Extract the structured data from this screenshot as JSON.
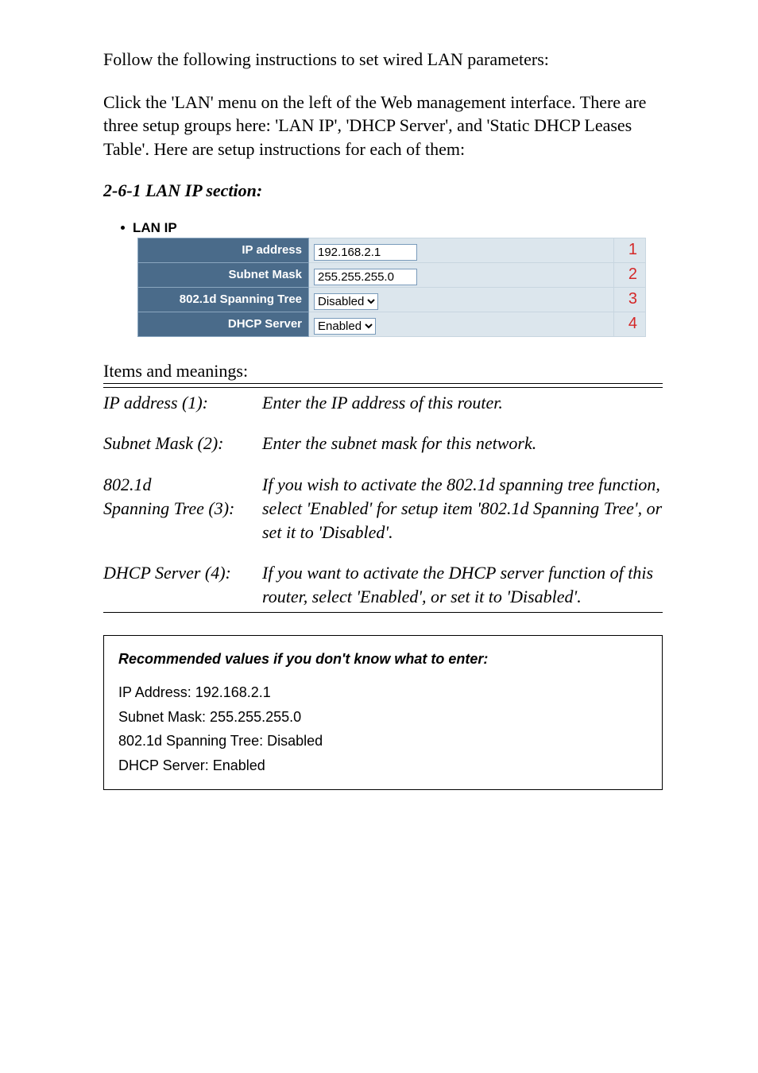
{
  "intro1": "Follow the following instructions to set wired LAN parameters:",
  "intro2": "Click the 'LAN' menu on the left of the Web management interface. There are three setup groups here: 'LAN IP', 'DHCP Server', and 'Static DHCP Leases Table'. Here are setup instructions for each of them:",
  "section_title": "2-6-1 LAN IP section:",
  "lanip": {
    "header": "LAN IP",
    "rows": [
      {
        "label": "IP address",
        "type": "text",
        "value": "192.168.2.1",
        "num": "1"
      },
      {
        "label": "Subnet Mask",
        "type": "text",
        "value": "255.255.255.0",
        "num": "2"
      },
      {
        "label": "802.1d Spanning Tree",
        "type": "select",
        "value": "Disabled",
        "num": "3"
      },
      {
        "label": "DHCP Server",
        "type": "select",
        "value": "Enabled",
        "num": "4"
      }
    ]
  },
  "meanings_head": "Items and meanings:",
  "meanings": [
    {
      "left": "IP address (1):",
      "right": "Enter the IP address of this router."
    },
    {
      "left": "Subnet Mask (2):",
      "right": "Enter the subnet mask for this network."
    },
    {
      "left": "802.1d",
      "left2": "Spanning Tree (3):",
      "right": "If you wish to activate the 802.1d spanning tree function, select 'Enabled' for setup item '802.1d Spanning Tree', or set it to 'Disabled'."
    },
    {
      "left": "DHCP Server (4):",
      "right": "If you want to activate the DHCP server function of this router, select 'Enabled', or set it to 'Disabled'."
    }
  ],
  "recbox": {
    "title": "Recommended values if you don't know what to enter:",
    "lines": [
      "IP Address: 192.168.2.1",
      "Subnet Mask: 255.255.255.0",
      "802.1d Spanning Tree: Disabled",
      "DHCP Server: Enabled"
    ]
  }
}
